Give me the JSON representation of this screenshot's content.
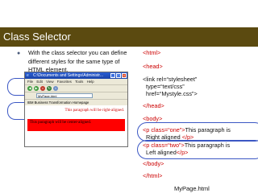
{
  "slide": {
    "title": "Class Selector",
    "bullet": "With the class selector you can define different styles for the same type of HTML element.",
    "caption": "MyPage.html",
    "colors": {
      "title_bar": "#5b4a10",
      "tag_color": "#cc0000",
      "highlight": "#3b57c4"
    }
  },
  "code": {
    "html_open": "<html>",
    "head_open": "<head>",
    "link_line1": "<link rel=“stylesheet”",
    "link_line2": "  type=“text/css”",
    "link_line3": "  href=“Mystyle.css”>",
    "head_close": "</head>",
    "body_open": "<body>",
    "p_one_open": "<p class=“one”>",
    "p_one_text1": "This paragraph is",
    "p_one_text2": "  Right aligned ",
    "p_close": "</p>",
    "p_two_open": "<p class=“two”>",
    "p_two_text1": "This paragraph is",
    "p_two_text2": "  Left aligned",
    "body_close": "</body>",
    "html_close": "</html>"
  },
  "browser": {
    "title": "C:\\Documents and Settings\\Administr...",
    "menu": [
      "File",
      "Edit",
      "View",
      "Favorites",
      "Tools",
      "Help"
    ],
    "address": "MyPage.html",
    "links": "IBM Business Transformation Homepage",
    "para_one": "This paragraph will be right-aligned.",
    "para_two": "This paragraph will be center-aligned."
  }
}
